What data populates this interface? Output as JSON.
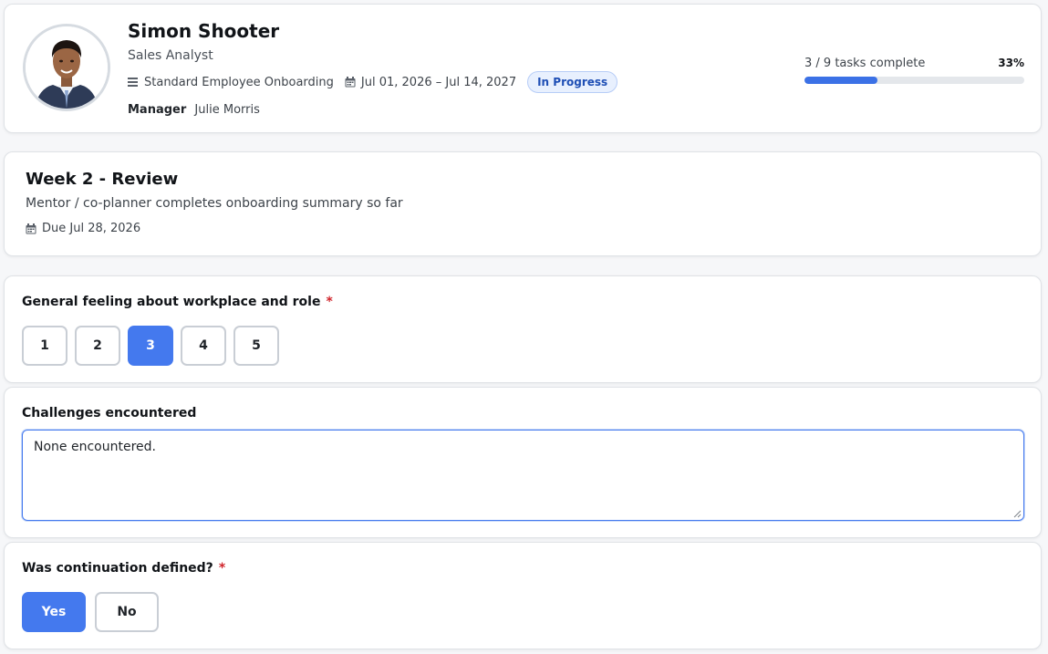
{
  "employee": {
    "name": "Simon Shooter",
    "role": "Sales Analyst",
    "avatar_icon": "employee-photo",
    "template_icon": "list-icon",
    "template": "Standard Employee Onboarding",
    "date_icon": "calendar-icon",
    "date_range": "Jul 01, 2026 – Jul 14, 2027",
    "status": "In Progress",
    "manager_label": "Manager",
    "manager_name": "Julie Morris"
  },
  "progress": {
    "text": "3 / 9 tasks complete",
    "percent_label": "33%",
    "completed": 3,
    "total": 9,
    "fraction": 0.33
  },
  "task": {
    "title": "Week 2 - Review",
    "description": "Mentor / co-planner completes onboarding summary so far",
    "due_icon": "calendar-icon",
    "due": "Due Jul 28, 2026"
  },
  "questions": {
    "q1": {
      "label": "General feeling about workplace and role",
      "required_mark": "*",
      "options": [
        "1",
        "2",
        "3",
        "4",
        "5"
      ],
      "selected": "3"
    },
    "q2": {
      "label": "Challenges encountered",
      "value": "None encountered."
    },
    "q3": {
      "label": "Was continuation defined?",
      "required_mark": "*",
      "yes_label": "Yes",
      "no_label": "No",
      "selected": "Yes"
    }
  },
  "colors": {
    "accent": "#4479ee",
    "progress_fill": "#3b71e6",
    "required": "#d0242b",
    "badge_bg": "#e8f0fe",
    "badge_text": "#1f4fb5"
  }
}
